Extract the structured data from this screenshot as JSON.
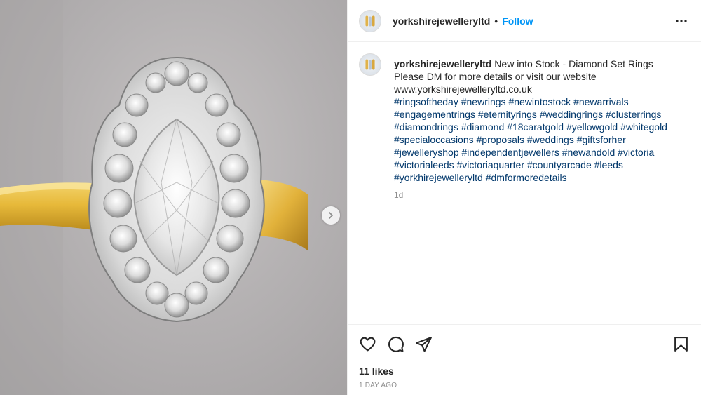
{
  "post": {
    "username": "yorkshirejewelleryltd",
    "follow_label": "Follow",
    "separator": "•",
    "caption": {
      "username": "yorkshirejewelleryltd",
      "headline": "New into Stock - Diamond Set Rings",
      "body_line1": "Please DM for more details or visit our website",
      "body_line2": "www.yorkshirejewelleryltd.co.uk",
      "hashtags": [
        "#ringsoftheday",
        "#newrings",
        "#newintostock",
        "#newarrivals",
        "#engagementrings",
        "#eternityrings",
        "#weddingrings",
        "#clusterrings",
        "#diamondrings",
        "#diamond",
        "#18caratgold",
        "#yellowgold",
        "#whitegold",
        "#specialoccasions",
        "#proposals",
        "#weddings",
        "#giftsforher",
        "#jewelleryshop",
        "#independentjewellers",
        "#newandold",
        "#victoria",
        "#victorialeeds",
        "#victoriaquarter",
        "#countyarcade",
        "#leeds",
        "#yorkhirejewelleryltd",
        "#dmformoredetails"
      ],
      "hashtag_rows": [
        4,
        4,
        5,
        4,
        4,
        4,
        2
      ],
      "age": "1d"
    },
    "likes": "11 likes",
    "date": "1 day ago"
  },
  "icons": {
    "more": "more-options-icon",
    "like": "heart-icon",
    "comment": "comment-icon",
    "share": "share-icon",
    "save": "bookmark-icon",
    "next": "chevron-right-icon"
  },
  "colors": {
    "link": "#0095f6",
    "hashtag": "#00376b",
    "muted": "#8e8e8e",
    "text": "#262626",
    "divider": "#efefef"
  }
}
